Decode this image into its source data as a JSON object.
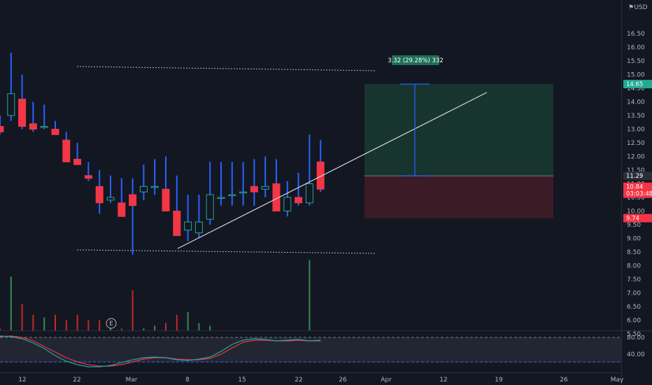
{
  "currency": "USD",
  "price_axis": {
    "labels": [
      "16.50",
      "16.00",
      "15.50",
      "15.00",
      "14.50",
      "14.00",
      "13.50",
      "13.00",
      "12.50",
      "12.00",
      "11.50",
      "11.00",
      "10.50",
      "10.00",
      "9.50",
      "9.00",
      "8.50",
      "8.00",
      "7.50",
      "7.00",
      "6.50",
      "6.00",
      "5.50"
    ]
  },
  "time_axis": {
    "labels": [
      "12",
      "22",
      "Mar",
      "8",
      "15",
      "22",
      "26",
      "Apr",
      "12",
      "19",
      "26",
      "May"
    ]
  },
  "oscillator_axis": {
    "labels": [
      "80.00",
      "40.00"
    ]
  },
  "measure_label": "3.32 (29.28%) 332",
  "price_tags": [
    {
      "key": "target",
      "text": "14.65",
      "color": "#22ab94"
    },
    {
      "key": "entry",
      "text": "11.29",
      "color": "#2a2e39"
    },
    {
      "key": "last",
      "text": "10.84",
      "color": "#f23645"
    },
    {
      "key": "countdown",
      "text": "03:03:48",
      "color": "#f23645"
    },
    {
      "key": "stop",
      "text": "9.74",
      "color": "#f23645"
    }
  ],
  "earnings_marker": "E",
  "colors": {
    "up_wick": "#2962ff",
    "down_body": "#f23645",
    "up_body": "#26a69a",
    "volume_green": "#2e7d32",
    "volume_red": "#b71c1c",
    "profit_zone": "#1e4d3a",
    "loss_zone": "#4d2028",
    "stoch_k": "#26a69a",
    "stoch_d": "#f23645"
  },
  "chart_data": {
    "type": "candlestick",
    "candles": [
      {
        "o": 13.1,
        "h": 13.5,
        "l": 12.8,
        "c": 12.9,
        "v": 5.7
      },
      {
        "o": 13.5,
        "h": 15.8,
        "l": 13.3,
        "c": 14.3,
        "v": 7.6
      },
      {
        "o": 14.1,
        "h": 15.0,
        "l": 13.0,
        "c": 13.1,
        "v": 6.6
      },
      {
        "o": 13.2,
        "h": 14.0,
        "l": 12.9,
        "c": 13.0,
        "v": 6.2
      },
      {
        "o": 13.1,
        "h": 13.9,
        "l": 13.0,
        "c": 13.1,
        "v": 6.1
      },
      {
        "o": 13.0,
        "h": 13.3,
        "l": 12.8,
        "c": 12.8,
        "v": 6.2
      },
      {
        "o": 12.6,
        "h": 12.9,
        "l": 11.8,
        "c": 11.8,
        "v": 6.0
      },
      {
        "o": 11.9,
        "h": 12.5,
        "l": 11.7,
        "c": 11.7,
        "v": 6.2
      },
      {
        "o": 11.3,
        "h": 11.8,
        "l": 11.1,
        "c": 11.2,
        "v": 6.0
      },
      {
        "o": 10.9,
        "h": 11.5,
        "l": 9.9,
        "c": 10.3,
        "v": 6.0
      },
      {
        "o": 10.4,
        "h": 11.3,
        "l": 10.3,
        "c": 10.5,
        "v": 5.9
      },
      {
        "o": 10.3,
        "h": 11.2,
        "l": 9.9,
        "c": 9.8,
        "v": 5.7
      },
      {
        "o": 10.6,
        "h": 11.2,
        "l": 8.4,
        "c": 10.2,
        "v": 7.1
      },
      {
        "o": 10.7,
        "h": 11.7,
        "l": 10.4,
        "c": 10.9,
        "v": 5.7
      },
      {
        "o": 10.9,
        "h": 11.9,
        "l": 10.6,
        "c": 10.9,
        "v": 5.8
      },
      {
        "o": 10.8,
        "h": 12.0,
        "l": 10.1,
        "c": 10.0,
        "v": 5.9
      },
      {
        "o": 10.0,
        "h": 11.3,
        "l": 9.1,
        "c": 9.1,
        "v": 6.2
      },
      {
        "o": 9.3,
        "h": 10.6,
        "l": 8.9,
        "c": 9.6,
        "v": 6.3
      },
      {
        "o": 9.2,
        "h": 10.6,
        "l": 9.0,
        "c": 9.6,
        "v": 5.9
      },
      {
        "o": 9.7,
        "h": 11.8,
        "l": 9.5,
        "c": 10.6,
        "v": 5.8
      },
      {
        "o": 10.5,
        "h": 11.8,
        "l": 10.2,
        "c": 10.5,
        "v": 5.6
      },
      {
        "o": 10.6,
        "h": 11.8,
        "l": 10.2,
        "c": 10.6,
        "v": 5.5
      },
      {
        "o": 10.7,
        "h": 11.8,
        "l": 10.2,
        "c": 10.7,
        "v": 5.6
      },
      {
        "o": 10.9,
        "h": 11.9,
        "l": 10.2,
        "c": 10.7,
        "v": 5.6
      },
      {
        "o": 10.8,
        "h": 12.0,
        "l": 10.5,
        "c": 10.9,
        "v": 5.5
      },
      {
        "o": 11.0,
        "h": 11.9,
        "l": 10.2,
        "c": 10.0,
        "v": 5.5
      },
      {
        "o": 10.0,
        "h": 11.1,
        "l": 9.8,
        "c": 10.5,
        "v": 5.4
      },
      {
        "o": 10.5,
        "h": 11.4,
        "l": 10.2,
        "c": 10.3,
        "v": 5.5
      },
      {
        "o": 10.3,
        "h": 12.8,
        "l": 10.2,
        "c": 11.0,
        "v": 8.2
      },
      {
        "o": 11.8,
        "h": 12.6,
        "l": 10.7,
        "c": 10.8,
        "v": 5.5
      }
    ],
    "price_range": [
      5.2,
      17.0
    ]
  }
}
